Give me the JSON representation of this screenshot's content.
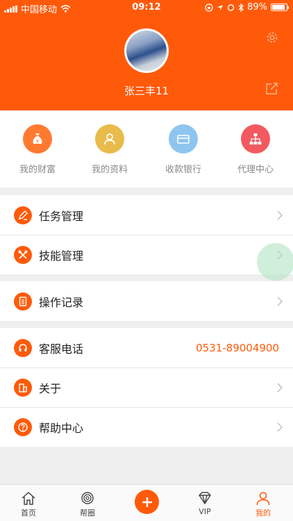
{
  "status_bar": {
    "carrier": "中国移动",
    "time": "09:12",
    "battery": "89%",
    "battery_level": 0.89
  },
  "profile": {
    "username": "张三丰11",
    "avatar_icon": "avatar-photo",
    "settings_icon": "gear-icon",
    "share_icon": "share-icon"
  },
  "shortcuts": [
    {
      "label": "我的财富",
      "icon": "money-bag-icon",
      "color": "#ff7a30"
    },
    {
      "label": "我的资料",
      "icon": "user-icon",
      "color": "#e8bb4a"
    },
    {
      "label": "收款银行",
      "icon": "card-icon",
      "color": "#8ec5f0"
    },
    {
      "label": "代理中心",
      "icon": "org-chart-icon",
      "color": "#f25a5f"
    }
  ],
  "menu": {
    "task": "任务管理",
    "skill": "技能管理",
    "record": "操作记录",
    "service": "客服电话",
    "service_phone": "0531-89004900",
    "about": "关于",
    "help": "帮助中心"
  },
  "tabbar": {
    "home": "首页",
    "circle": "帮圈",
    "vip": "VIP",
    "mine": "我的"
  },
  "colors": {
    "accent": "#ff5a0a",
    "background": "#efefef"
  }
}
